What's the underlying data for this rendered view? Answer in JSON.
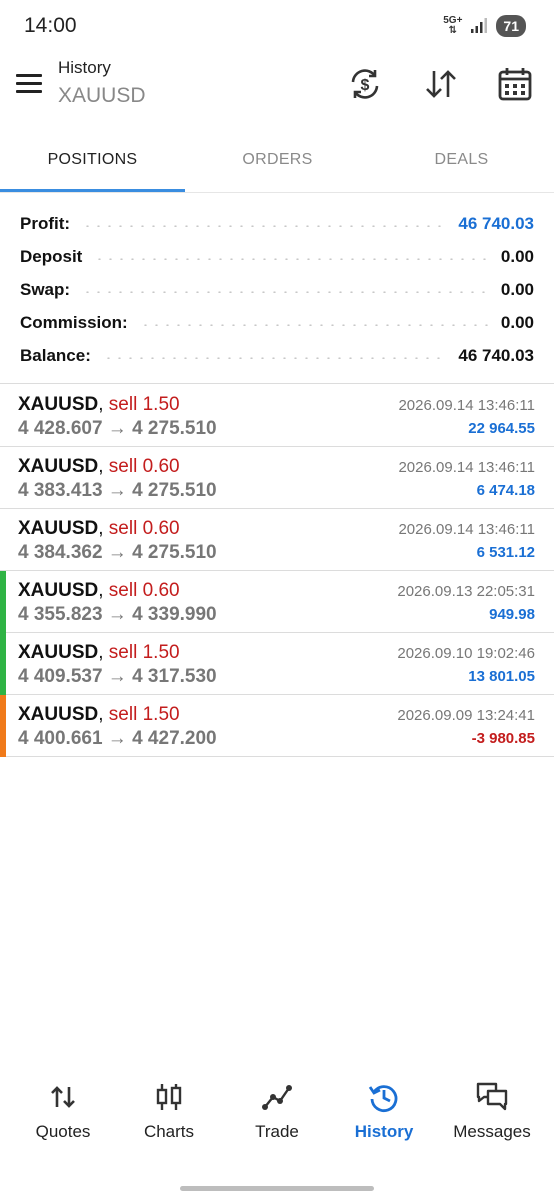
{
  "status_bar": {
    "time": "14:00",
    "network": "5G+",
    "battery": "71"
  },
  "header": {
    "title": "History",
    "subtitle": "XAUUSD",
    "icons": [
      "menu-icon",
      "currency-refresh-icon",
      "sort-arrows-icon",
      "calendar-icon"
    ]
  },
  "tabs": [
    {
      "label": "POSITIONS",
      "active": true
    },
    {
      "label": "ORDERS",
      "active": false
    },
    {
      "label": "DEALS",
      "active": false
    }
  ],
  "summary": [
    {
      "label": "Profit:",
      "value": "46 740.03",
      "highlight": true
    },
    {
      "label": "Deposit",
      "value": "0.00",
      "highlight": false
    },
    {
      "label": "Swap:",
      "value": "0.00",
      "highlight": false
    },
    {
      "label": "Commission:",
      "value": "0.00",
      "highlight": false
    },
    {
      "label": "Balance:",
      "value": "46 740.03",
      "highlight": false
    }
  ],
  "positions": [
    {
      "symbol": "XAUUSD",
      "side": "sell",
      "volume": "1.50",
      "prices": "4 428.607 → 4 275.510",
      "time": "2026.09.14 13:46:11",
      "profit": "22 964.55",
      "marker": ""
    },
    {
      "symbol": "XAUUSD",
      "side": "sell",
      "volume": "0.60",
      "prices": "4 383.413 → 4 275.510",
      "time": "2026.09.14 13:46:11",
      "profit": "6 474.18",
      "marker": ""
    },
    {
      "symbol": "XAUUSD",
      "side": "sell",
      "volume": "0.60",
      "prices": "4 384.362 → 4 275.510",
      "time": "2026.09.14 13:46:11",
      "profit": "6 531.12",
      "marker": ""
    },
    {
      "symbol": "XAUUSD",
      "side": "sell",
      "volume": "0.60",
      "prices": "4 355.823 → 4 339.990",
      "time": "2026.09.13 22:05:31",
      "profit": "949.98",
      "marker": "#2fb344"
    },
    {
      "symbol": "XAUUSD",
      "side": "sell",
      "volume": "1.50",
      "prices": "4 409.537 → 4 317.530",
      "time": "2026.09.10 19:02:46",
      "profit": "13 801.05",
      "marker": "#2fb344"
    },
    {
      "symbol": "XAUUSD",
      "side": "sell",
      "volume": "1.50",
      "prices": "4 400.661 → 4 427.200",
      "time": "2026.09.09 13:24:41",
      "profit": "-3 980.85",
      "marker": "#f07a1a"
    }
  ],
  "colors": {
    "accent": "#1a6fd4",
    "sell": "#c31d1d",
    "profit_positive": "#1a6fd4",
    "profit_negative": "#c31d1d"
  },
  "bottom_nav": [
    {
      "label": "Quotes",
      "icon": "quotes-arrows-icon",
      "active": false
    },
    {
      "label": "Charts",
      "icon": "candlestick-icon",
      "active": false
    },
    {
      "label": "Trade",
      "icon": "trade-line-icon",
      "active": false
    },
    {
      "label": "History",
      "icon": "history-clock-icon",
      "active": true
    },
    {
      "label": "Messages",
      "icon": "messages-icon",
      "active": false
    }
  ]
}
